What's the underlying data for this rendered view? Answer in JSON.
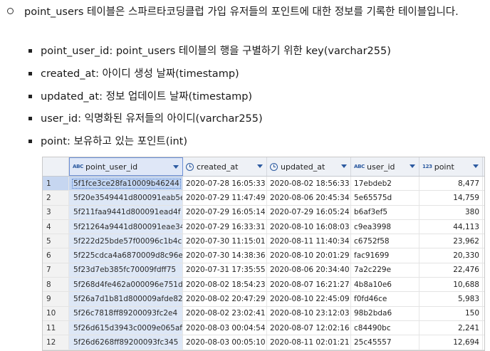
{
  "intro": "point_users 테이블은 스파르타코딩클럽 가입 유저들의 포인트에 대한 정보를 기록한 테이블입니다.",
  "fields": [
    {
      "name": "point_user_id",
      "desc": ": point_users 테이블의 행을 구별하기 위한 key(varchar255)"
    },
    {
      "name": "created_at",
      "desc": ": 아이디 생성 날짜(timestamp)"
    },
    {
      "name": "updated_at",
      "desc": ": 정보 업데이트 날짜(timestamp)"
    },
    {
      "name": "user_id",
      "desc": ": 익명화된 유저들의 아이디(varchar255)"
    },
    {
      "name": "point",
      "desc": ": 보유하고 있는 포인트(int)"
    }
  ],
  "table": {
    "columns": [
      {
        "label": "point_user_id",
        "type_icon": "ABC"
      },
      {
        "label": "created_at",
        "type_icon": "clock"
      },
      {
        "label": "updated_at",
        "type_icon": "clock"
      },
      {
        "label": "user_id",
        "type_icon": "ABC"
      },
      {
        "label": "point",
        "type_icon": "123"
      }
    ],
    "rows": [
      {
        "n": "1",
        "id": "5f1fce3ce28fa10009b46244",
        "created": "2020-07-28 16:05:33",
        "updated": "2020-08-02 18:56:33",
        "user": "17ebdeb2",
        "point": "8,477"
      },
      {
        "n": "2",
        "id": "5f20e3549441d800091eab5e",
        "created": "2020-07-29 11:47:49",
        "updated": "2020-08-06 20:45:34",
        "user": "5e65575d",
        "point": "14,759"
      },
      {
        "n": "3",
        "id": "5f211faa9441d800091ead4f",
        "created": "2020-07-29 16:05:14",
        "updated": "2020-07-29 16:05:24",
        "user": "b6af3ef5",
        "point": "380"
      },
      {
        "n": "4",
        "id": "5f21264a9441d800091eae34",
        "created": "2020-07-29 16:33:31",
        "updated": "2020-08-10 16:08:03",
        "user": "c9ea3998",
        "point": "44,113"
      },
      {
        "n": "5",
        "id": "5f222d25bde57f00096c1b4c",
        "created": "2020-07-30 11:15:01",
        "updated": "2020-08-11 11:40:34",
        "user": "c6752f58",
        "point": "23,962"
      },
      {
        "n": "6",
        "id": "5f225cdca4a6870009d8c96e",
        "created": "2020-07-30 14:38:36",
        "updated": "2020-08-10 20:01:29",
        "user": "fac91699",
        "point": "20,330"
      },
      {
        "n": "7",
        "id": "5f23d7eb385fc70009fdff75",
        "created": "2020-07-31 17:35:55",
        "updated": "2020-08-06 20:34:40",
        "user": "7a2c229e",
        "point": "22,476"
      },
      {
        "n": "8",
        "id": "5f268d4fe462a000096e751d",
        "created": "2020-08-02 18:54:23",
        "updated": "2020-08-07 16:21:27",
        "user": "4b8a10e6",
        "point": "10,688"
      },
      {
        "n": "9",
        "id": "5f26a7d1b81d800009afde82",
        "created": "2020-08-02 20:47:29",
        "updated": "2020-08-10 22:45:09",
        "user": "f0fd46ce",
        "point": "5,983"
      },
      {
        "n": "10",
        "id": "5f26c7818ff89200093fc2e4",
        "created": "2020-08-02 23:02:41",
        "updated": "2020-08-10 23:12:03",
        "user": "98b2bda6",
        "point": "150"
      },
      {
        "n": "11",
        "id": "5f26d615d3943c0009e065af",
        "created": "2020-08-03 00:04:54",
        "updated": "2020-08-07 12:02:16",
        "user": "c84490bc",
        "point": "2,241"
      },
      {
        "n": "12",
        "id": "5f26d6268ff89200093fc345",
        "created": "2020-08-03 00:05:10",
        "updated": "2020-08-11 02:01:21",
        "user": "25c45557",
        "point": "12,694"
      }
    ]
  }
}
